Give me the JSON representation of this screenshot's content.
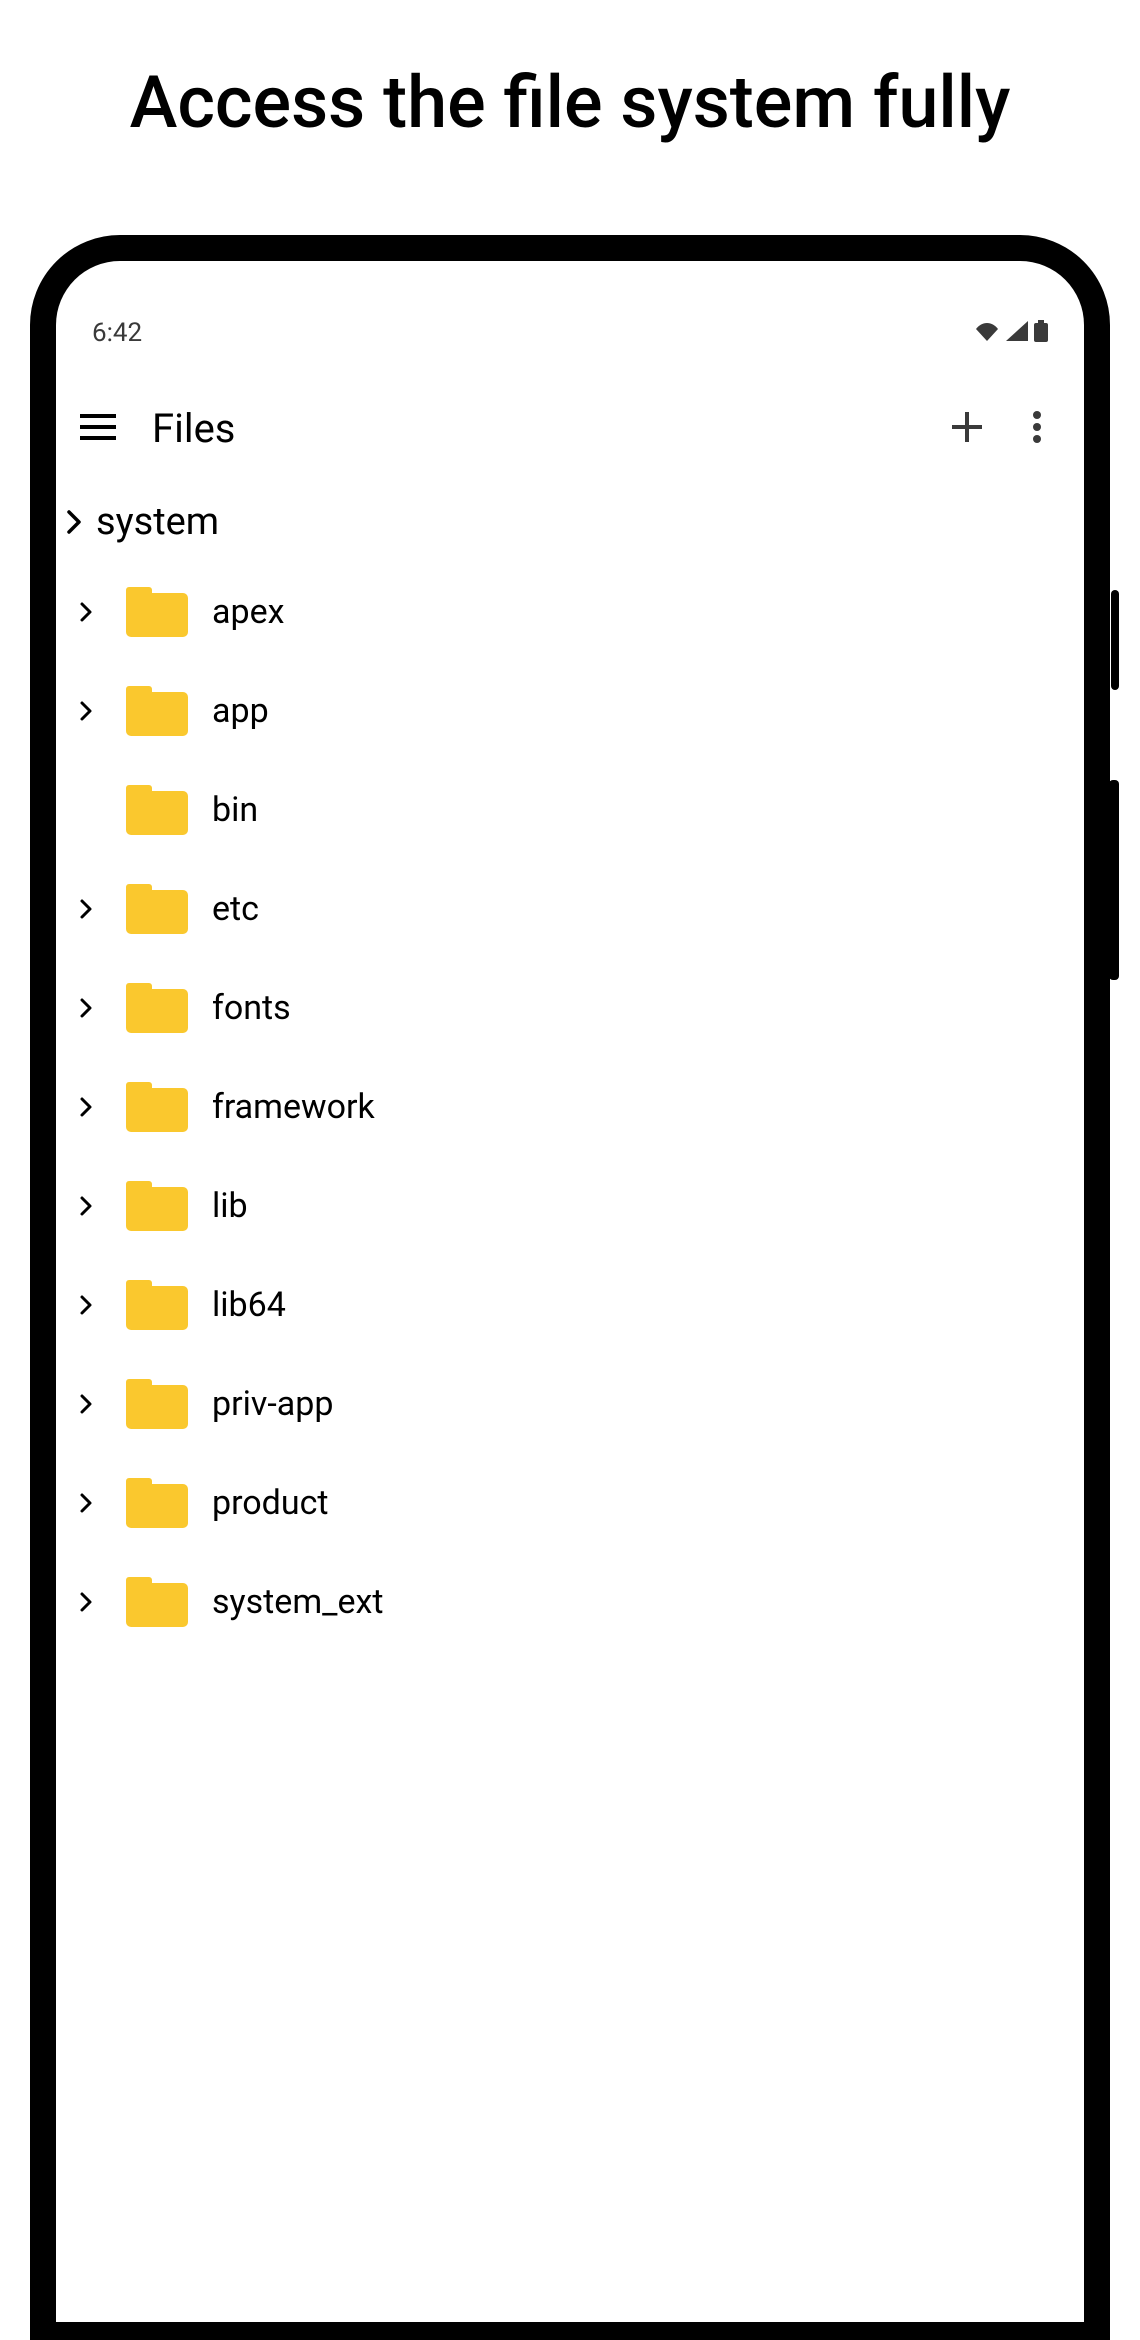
{
  "headline": "Access the file system fully",
  "status": {
    "time": "6:42"
  },
  "app_bar": {
    "title": "Files"
  },
  "breadcrumb": {
    "label": "system"
  },
  "folders": [
    {
      "name": "apex",
      "expandable": true
    },
    {
      "name": "app",
      "expandable": true
    },
    {
      "name": "bin",
      "expandable": false
    },
    {
      "name": "etc",
      "expandable": true
    },
    {
      "name": "fonts",
      "expandable": true
    },
    {
      "name": "framework",
      "expandable": true
    },
    {
      "name": "lib",
      "expandable": true
    },
    {
      "name": "lib64",
      "expandable": true
    },
    {
      "name": "priv-app",
      "expandable": true
    },
    {
      "name": "product",
      "expandable": true
    },
    {
      "name": "system_ext",
      "expandable": true
    }
  ],
  "colors": {
    "folder": "#fac82e",
    "icon": "#3a3a3a"
  }
}
